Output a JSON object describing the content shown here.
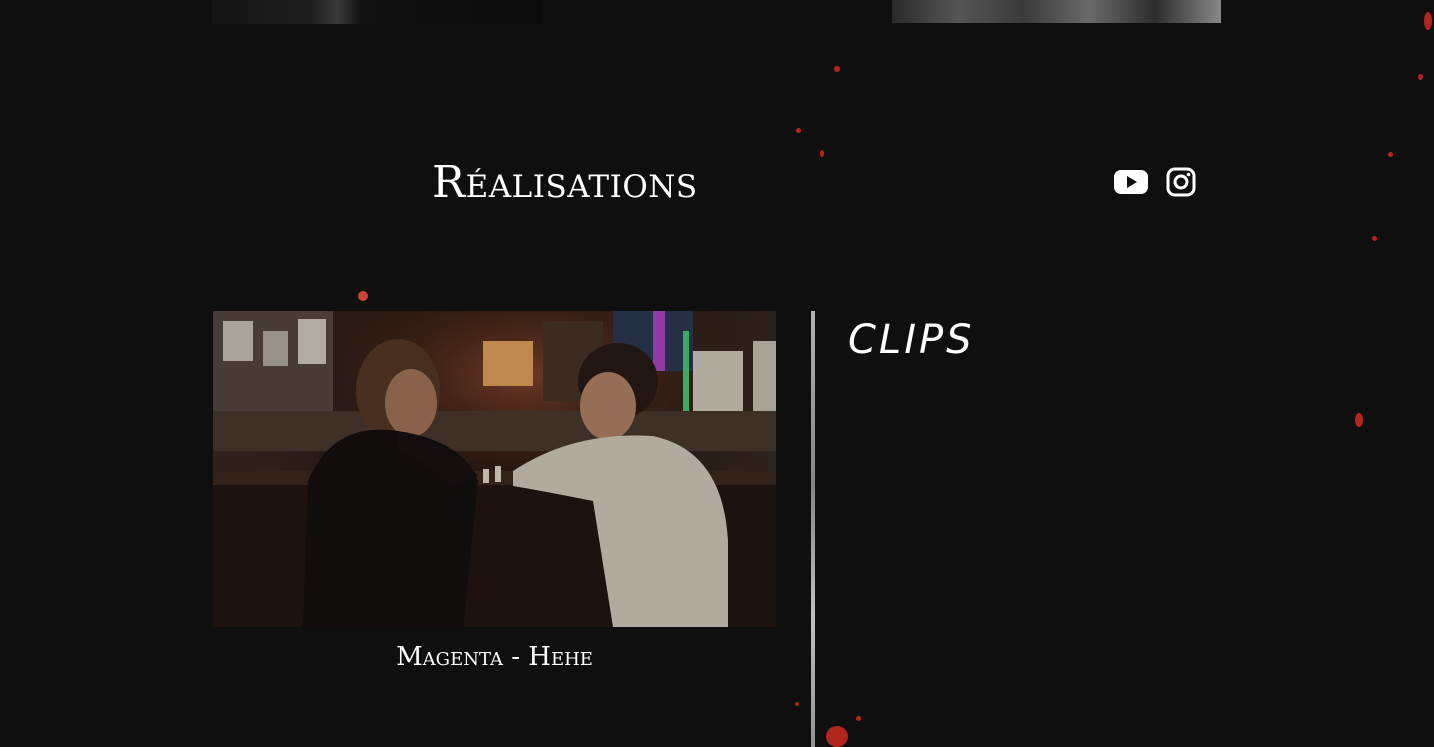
{
  "section": {
    "heading": "Réalisations",
    "category_label": "CLIPS"
  },
  "social": {
    "youtube_icon": "youtube-icon",
    "instagram_icon": "instagram-icon"
  },
  "video": {
    "title": "Magenta - Hehe",
    "thumbnail": "video-thumbnail"
  },
  "colors": {
    "background": "#0f0f10",
    "text": "#ffffff",
    "accent_splatter": "#b3261e"
  }
}
